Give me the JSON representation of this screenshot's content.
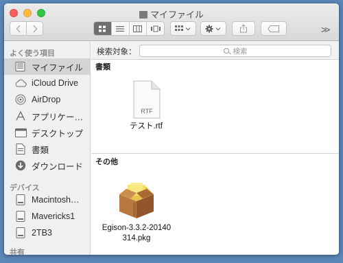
{
  "window": {
    "title": "マイファイル"
  },
  "toolbar": {
    "back_label": "<",
    "forward_label": ">",
    "more_label": ">>"
  },
  "sidebar": {
    "favorites_header": "よく使う項目",
    "favorites": [
      {
        "label": "マイファイル",
        "icon": "my-files-icon",
        "selected": true
      },
      {
        "label": "iCloud Drive",
        "icon": "cloud-icon"
      },
      {
        "label": "AirDrop",
        "icon": "airdrop-icon"
      },
      {
        "label": "アプリケー…",
        "icon": "applications-icon"
      },
      {
        "label": "デスクトップ",
        "icon": "desktop-icon"
      },
      {
        "label": "書類",
        "icon": "documents-icon"
      },
      {
        "label": "ダウンロード",
        "icon": "downloads-icon"
      }
    ],
    "devices_header": "デバイス",
    "devices": [
      {
        "label": "Macintosh…",
        "icon": "disk-icon"
      },
      {
        "label": "Mavericks1",
        "icon": "disk-icon"
      },
      {
        "label": "2TB3",
        "icon": "disk-icon"
      }
    ],
    "shared_header": "共有"
  },
  "search": {
    "scope_label": "検索対象：",
    "placeholder": "検索"
  },
  "groups": [
    {
      "header": "書類",
      "files": [
        {
          "name": "テスト.rtf",
          "badge": "RTF",
          "icon": "rtf-document-icon"
        }
      ]
    },
    {
      "header": "その他",
      "files": [
        {
          "name_line1": "Egison-3.3.2-20140",
          "name_line2": "314.pkg",
          "icon": "package-icon"
        }
      ]
    }
  ],
  "colors": {
    "desktop_background": "#5b86b8",
    "selected_sidebar": "#d4d4d4",
    "close": "#fc605c",
    "minimize": "#fdbc40",
    "zoom": "#34c84a"
  }
}
